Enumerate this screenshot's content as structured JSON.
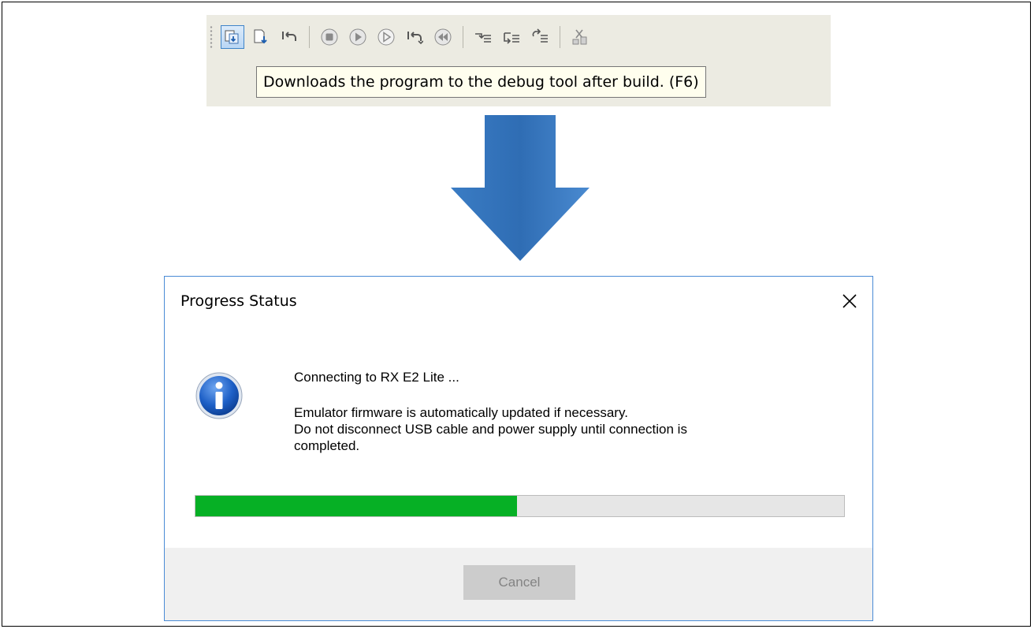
{
  "toolbar": {
    "buttons": [
      {
        "icon": "download-build-icon",
        "active": true
      },
      {
        "icon": "download-icon"
      },
      {
        "icon": "reset-icon"
      },
      {
        "icon": "stop-icon"
      },
      {
        "icon": "go-icon"
      },
      {
        "icon": "run-icon"
      },
      {
        "icon": "restart-icon"
      },
      {
        "icon": "step-back-icon"
      },
      {
        "icon": "step-in-icon"
      },
      {
        "icon": "step-over-icon"
      },
      {
        "icon": "return-out-icon"
      },
      {
        "icon": "disconnect-icon"
      }
    ],
    "tooltip": "Downloads the program to the debug tool after build. (F6)"
  },
  "dialog": {
    "title": "Progress Status",
    "close_glyph": "✕",
    "message_line1": "Connecting to RX E2 Lite ...",
    "message_line2": "Emulator firmware is automatically updated if necessary.",
    "message_line3": "Do not disconnect USB cable and power supply until connection is",
    "message_line4": "completed.",
    "progress_fraction": 0.496,
    "cancel_label": "Cancel"
  },
  "colors": {
    "arrow_blue": "#2f6db4",
    "progress_green": "#06b025",
    "toolbar_bg": "#ecebe2",
    "tooltip_bg": "#fffeee"
  }
}
